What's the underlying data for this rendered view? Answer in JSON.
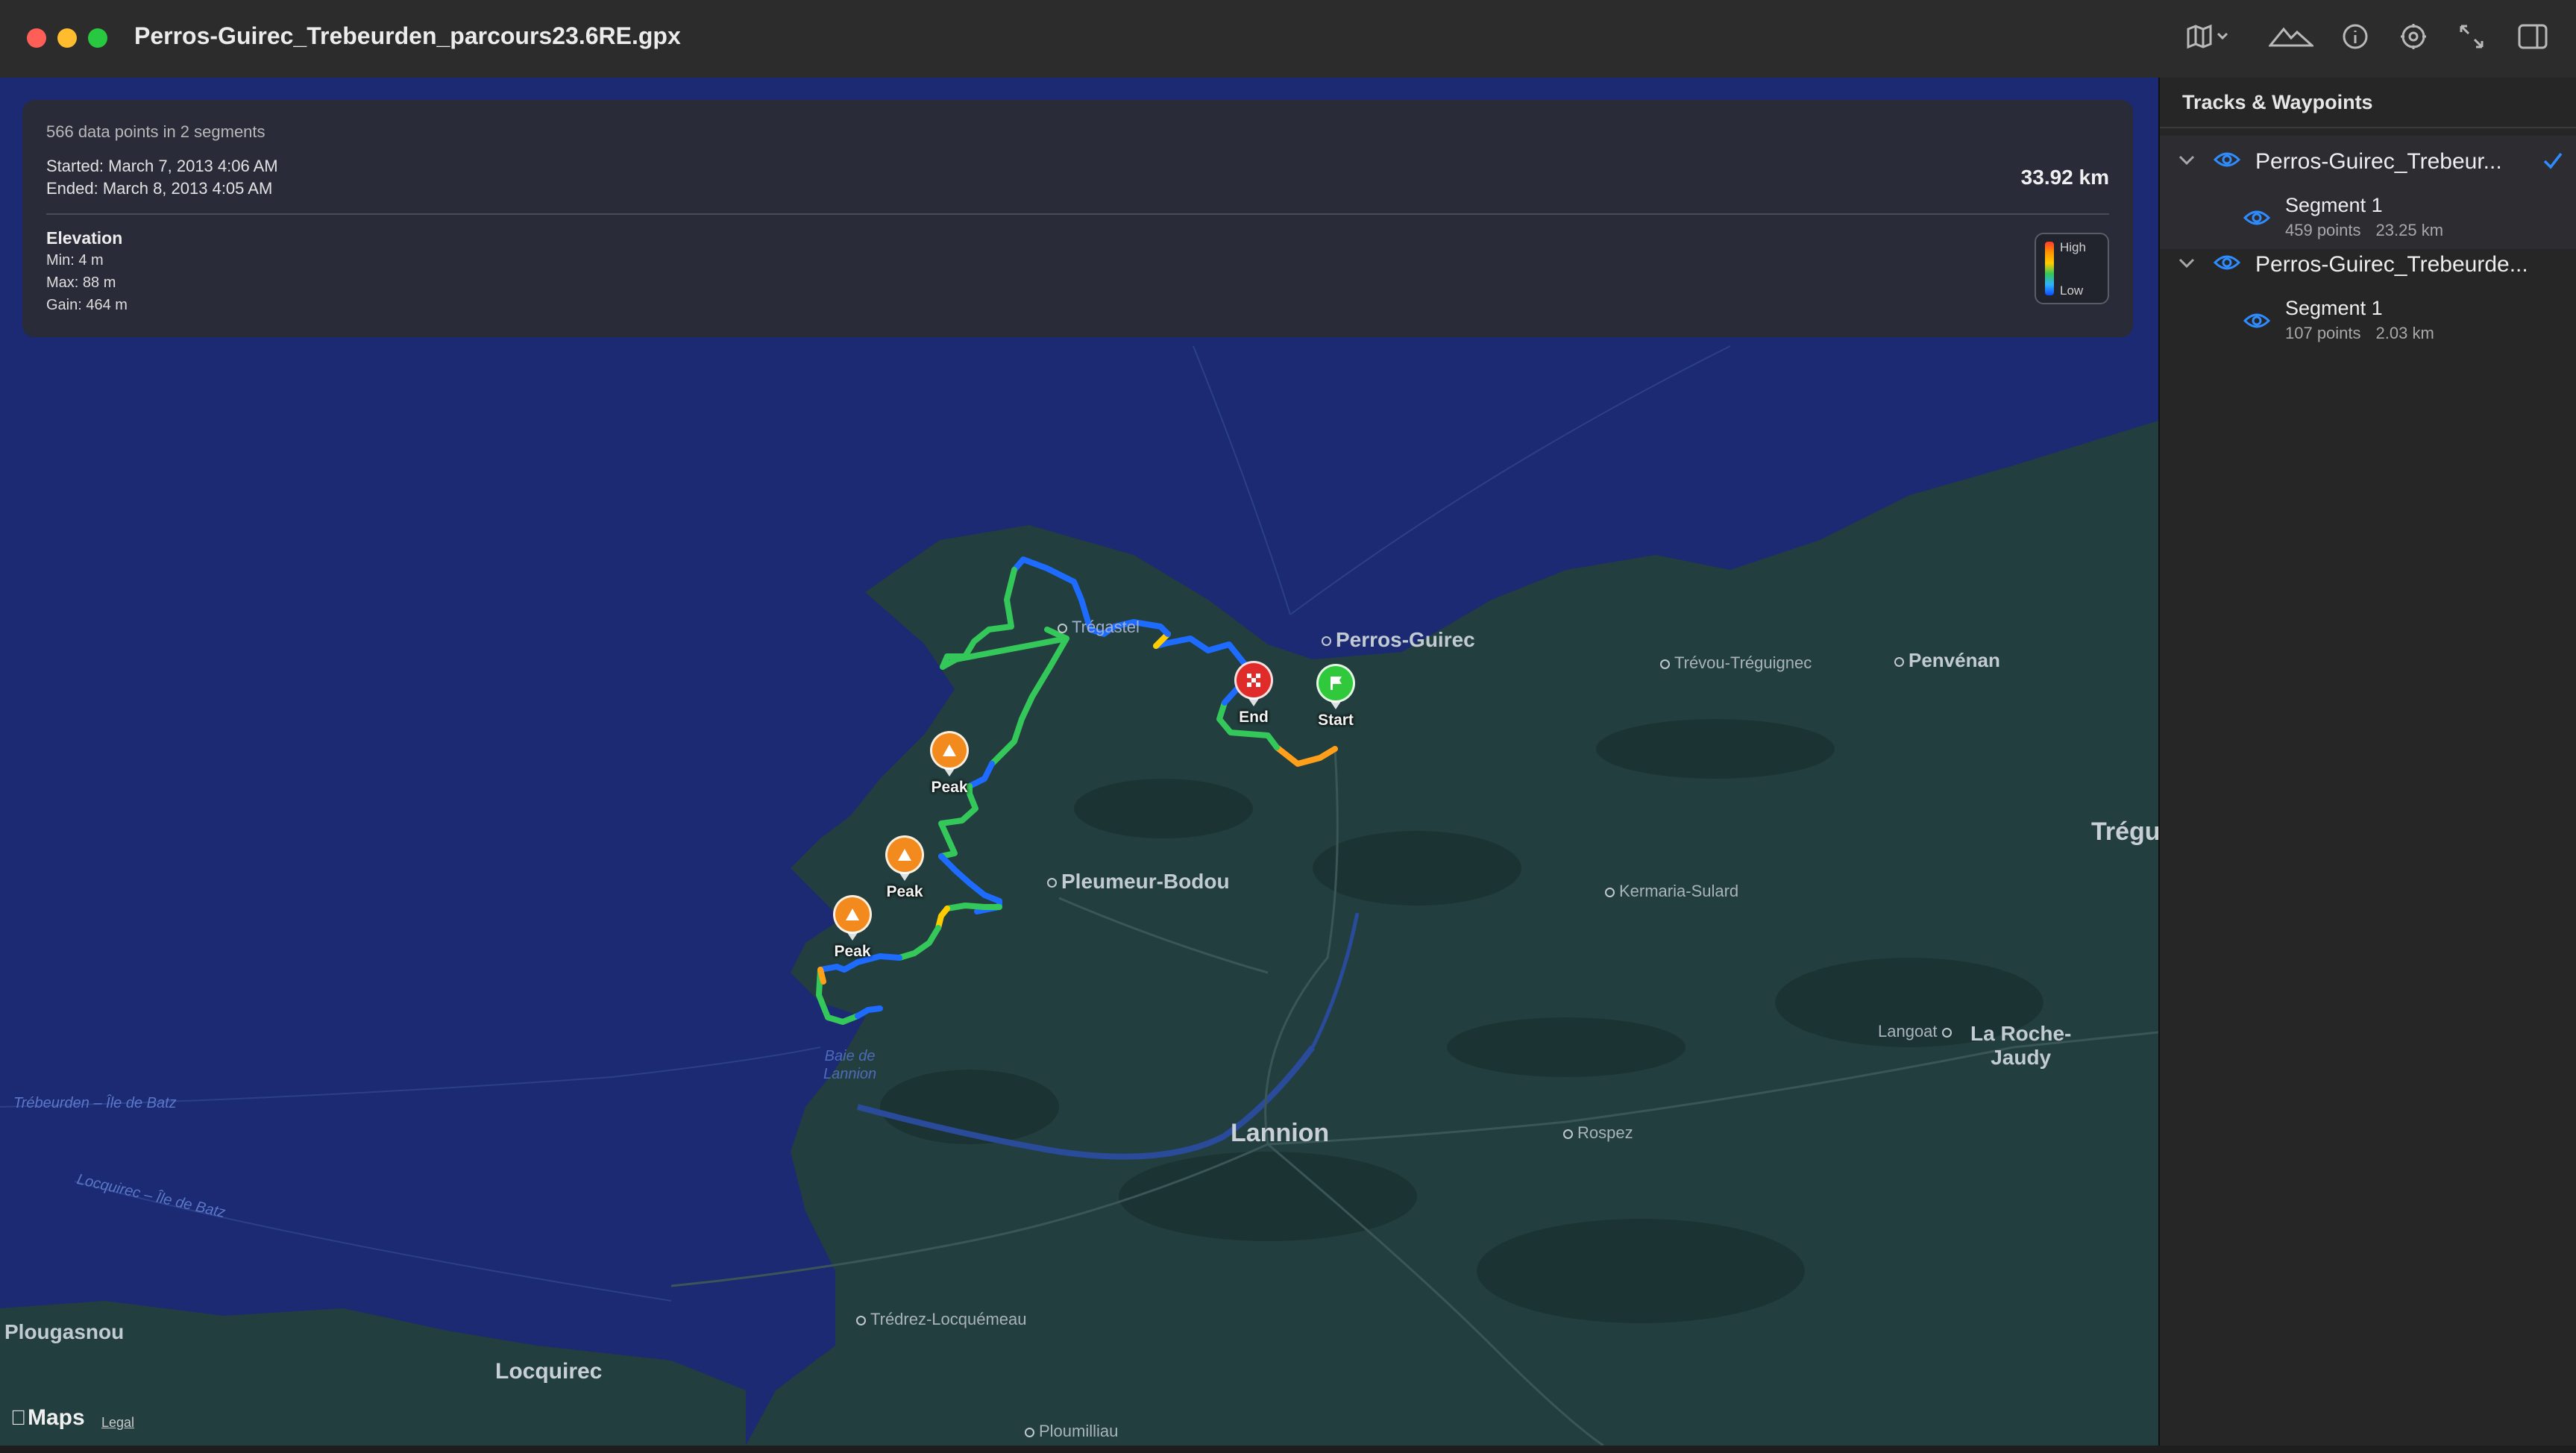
{
  "window": {
    "title": "Perros-Guirec_Trebeurden_parcours23.6RE.gpx",
    "toolbar": {
      "map_style_icon": "map-icon",
      "elevation_icon": "mountains-icon",
      "info_icon": "info-icon",
      "settings_icon": "gear-icon",
      "expand_icon": "expand-arrows-icon",
      "sidebar_icon": "sidebar-toggle-icon"
    }
  },
  "summary": {
    "points": "566 data points in 2 segments",
    "started": "Started: March 7, 2013 4:06 AM",
    "ended": "Ended: March 8, 2013 4:05 AM",
    "distance": "33.92 km",
    "elevation": {
      "title": "Elevation",
      "min": "Min: 4 m",
      "max": "Max: 88 m",
      "gain": "Gain: 464 m"
    },
    "legend": {
      "high": "High",
      "low": "Low"
    }
  },
  "map": {
    "places": {
      "perros_guirec": "Perros-Guirec",
      "tregastel": "Trégastel",
      "trevou": "Trévou-Tréguignec",
      "penvenan": "Penvénan",
      "pleumeur_bodou": "Pleumeur-Bodou",
      "kermaria": "Kermaria-Sulard",
      "treguier": "Trégui",
      "langoat": "Langoat",
      "la_roche_1": "La Roche-",
      "la_roche_2": "Jaudy",
      "lannion": "Lannion",
      "rospez": "Rospez",
      "baie_1": "Baie de",
      "baie_2": "Lannion",
      "trebeurden_batz": "Trébeurden – Île de Batz",
      "locquirec_batz": "Locquirec – Île de Batz",
      "plougasnou": "Plougasnou",
      "locquirec": "Locquirec",
      "tredrez": "Trédrez-Locquémeau",
      "ploumilliau": "Ploumilliau"
    },
    "markers": {
      "end": "End",
      "start": "Start",
      "peak_1": "Peak",
      "peak_2": "Peak",
      "peak_3": "Peak"
    },
    "attribution": {
      "maps": "Maps",
      "legal": "Legal"
    },
    "colors": {
      "water": "#1b2a72",
      "land": "#233e3e"
    }
  },
  "sidebar": {
    "title": "Tracks & Waypoints",
    "tracks": [
      {
        "name": "Perros-Guirec_Trebeurden_parcours23.6RE",
        "display": "Perros-Guirec_Trebeur...",
        "selected": true,
        "segments": [
          {
            "name": "Segment 1",
            "points": "459 points",
            "distance": "23.25 km"
          }
        ]
      },
      {
        "name": "Perros-Guirec_Trebeurden_parcours23.6RE",
        "display": "Perros-Guirec_Trebeurde...",
        "selected": false,
        "segments": [
          {
            "name": "Segment 1",
            "points": "107 points",
            "distance": "2.03 km"
          }
        ]
      }
    ]
  }
}
